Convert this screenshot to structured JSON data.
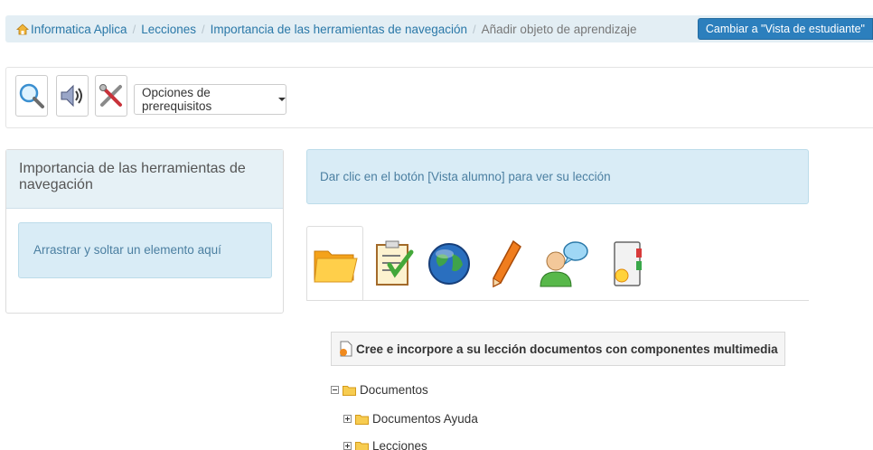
{
  "breadcrumb": {
    "home": "Informatica Aplica",
    "items": [
      "Lecciones",
      "Importancia de las herramientas de navegación"
    ],
    "current": "Añadir objeto de aprendizaje",
    "student_view_button": "Cambiar a \"Vista de estudiante\""
  },
  "toolbar": {
    "icons": [
      "magnifier-icon",
      "speaker-icon",
      "tools-icon"
    ],
    "prereq_label": "Opciones de prerequisitos"
  },
  "left_panel": {
    "title": "Importancia de las herramientas de navegación",
    "drop_text": "Arrastrar y soltar un elemento aquí"
  },
  "info_message": "Dar clic en el botón [Vista alumno] para ver su lección",
  "tabs": [
    "documents-folder-icon",
    "quiz-checklist-icon",
    "globe-link-icon",
    "pencil-assignment-icon",
    "forum-user-icon",
    "new-chapter-icon"
  ],
  "documents_panel": {
    "heading": "Cree e incorpore a su lección documentos con componentes multimedia",
    "tree": [
      {
        "label": "Documentos",
        "expanded": true,
        "level": 0
      },
      {
        "label": "Documentos Ayuda",
        "expanded": false,
        "level": 1
      },
      {
        "label": "Lecciones",
        "expanded": false,
        "level": 1
      }
    ]
  },
  "colors": {
    "accent": "#2c7fbd",
    "info_bg": "#d9ecf6",
    "breadcrumb_bg": "#e3eef4"
  }
}
